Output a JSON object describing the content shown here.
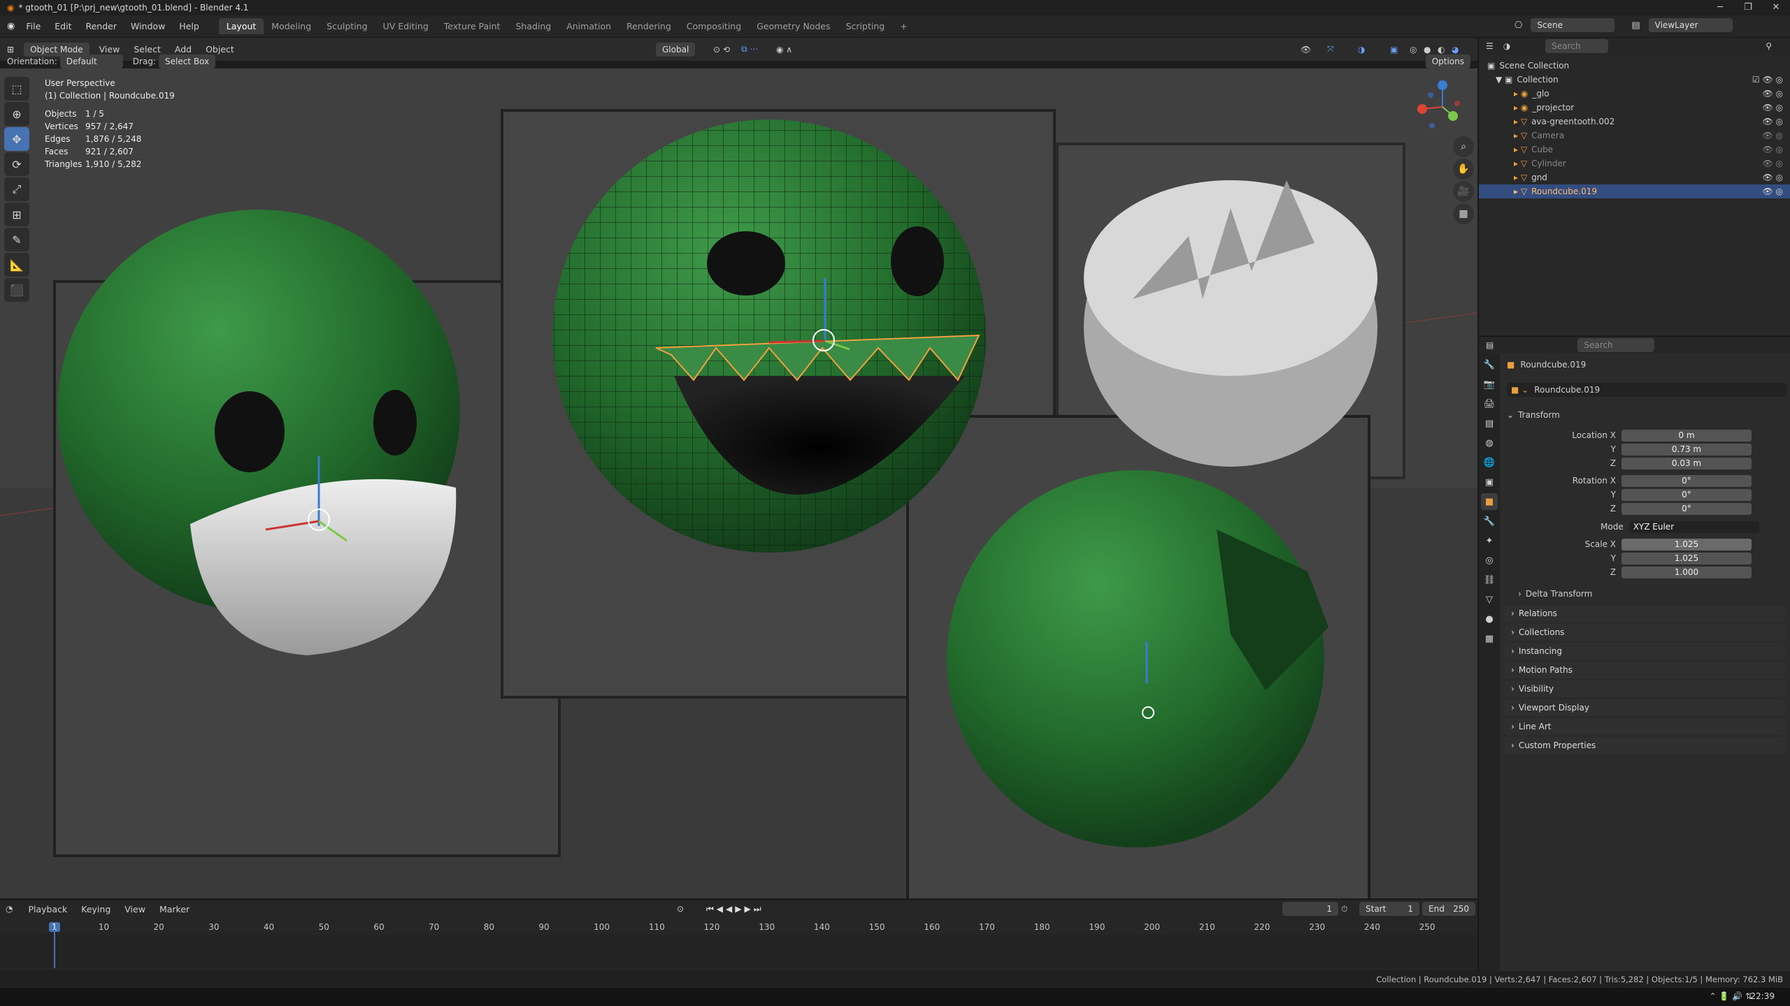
{
  "title": "* gtooth_01 [P:\\prj_new\\gtooth_01.blend] - Blender 4.1",
  "menus": [
    "File",
    "Edit",
    "Render",
    "Window",
    "Help"
  ],
  "workspaces": [
    "Layout",
    "Modeling",
    "Sculpting",
    "UV Editing",
    "Texture Paint",
    "Shading",
    "Animation",
    "Rendering",
    "Compositing",
    "Geometry Nodes",
    "Scripting"
  ],
  "scene": "Scene",
  "view_layer": "ViewLayer",
  "header": {
    "mode": "Object Mode",
    "menus": [
      "View",
      "Select",
      "Add",
      "Object"
    ],
    "transform": "Global",
    "orientation_label": "Orientation:",
    "orientation": "Default",
    "drag_label": "Drag:",
    "drag": "Select Box",
    "options": "Options"
  },
  "viewport": {
    "persp": "User Perspective",
    "collection": "(1) Collection | Roundcube.019",
    "stats": [
      {
        "k": "Objects",
        "v": "1 / 5"
      },
      {
        "k": "Vertices",
        "v": "957 / 2,647"
      },
      {
        "k": "Edges",
        "v": "1,876 / 5,248"
      },
      {
        "k": "Faces",
        "v": "921 / 2,607"
      },
      {
        "k": "Triangles",
        "v": "1,910 / 5,282"
      }
    ],
    "axes": {
      "x": "X",
      "y": "Y",
      "z": "Z"
    }
  },
  "timeline": {
    "menus": [
      "Playback",
      "Keying",
      "View",
      "Marker"
    ],
    "frame": "1",
    "start_label": "Start",
    "start": "1",
    "end_label": "End",
    "end": "250",
    "ticks": [
      "1",
      "10",
      "20",
      "30",
      "40",
      "50",
      "60",
      "70",
      "80",
      "90",
      "100",
      "110",
      "120",
      "130",
      "140",
      "150",
      "160",
      "170",
      "180",
      "190",
      "200",
      "210",
      "220",
      "230",
      "240",
      "250"
    ]
  },
  "status": "Collection | Roundcube.019 | Verts:2,647 | Faces:2,607 | Tris:5,282 | Objects:1/5 | Memory: 762.3 MiB",
  "clock": "22:39",
  "outliner": {
    "search": "Search",
    "root": "Scene Collection",
    "collection": "Collection",
    "items": [
      "_glo",
      "_projector",
      "ava-greentooth.002",
      "Camera",
      "Cube",
      "Cylinder",
      "gnd",
      "Roundcube.019"
    ]
  },
  "props": {
    "search": "Search",
    "object": "Roundcube.019",
    "object2": "Roundcube.019",
    "transform": "Transform",
    "loc_label": "Location X",
    "loc": [
      "0 m",
      "0.73 m",
      "0.03 m"
    ],
    "rot_label": "Rotation X",
    "rot": [
      "0°",
      "0°",
      "0°"
    ],
    "mode_label": "Mode",
    "mode": "XYZ Euler",
    "scale_label": "Scale X",
    "scale": [
      "1.025",
      "1.025",
      "1.000"
    ],
    "axis_y": "Y",
    "axis_z": "Z",
    "delta": "Delta Transform",
    "panels": [
      "Relations",
      "Collections",
      "Instancing",
      "Motion Paths",
      "Visibility",
      "Viewport Display",
      "Line Art",
      "Custom Properties"
    ]
  },
  "colors": {
    "accent": "#4772b3",
    "green": "#2e7d32",
    "selected": "#334d80"
  }
}
